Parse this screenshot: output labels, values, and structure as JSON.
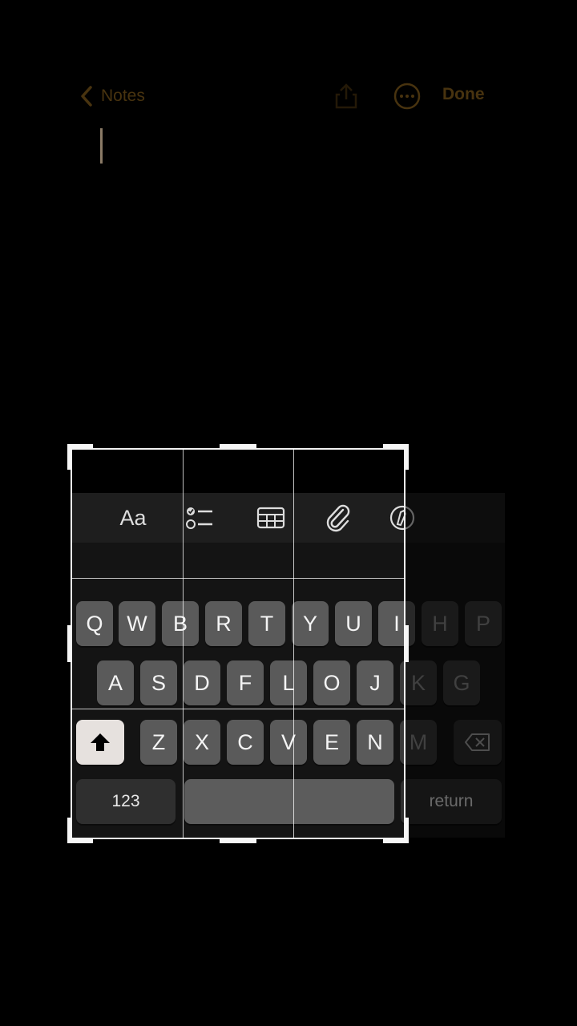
{
  "nav": {
    "back_label": "Notes",
    "done_label": "Done"
  },
  "icons": {
    "back": "chevron-left-icon",
    "share": "share-icon",
    "more": "ellipsis-circle-icon",
    "checklist": "checklist-icon",
    "table": "table-icon",
    "attach": "paperclip-icon",
    "markup": "markup-pen-icon",
    "delete": "backspace-icon",
    "shift": "shift-arrow-icon"
  },
  "toolbar": {
    "format_label": "Aa"
  },
  "keyboard": {
    "row1": [
      "Q",
      "W",
      "B",
      "R",
      "T",
      "Y",
      "U",
      "I",
      "H",
      "P"
    ],
    "row2": [
      "A",
      "S",
      "D",
      "F",
      "L",
      "O",
      "J",
      "K",
      "G"
    ],
    "row3": [
      "Z",
      "X",
      "C",
      "V",
      "E",
      "N",
      "M"
    ],
    "numbers_label": "123",
    "return_label": "return"
  },
  "colors": {
    "accent": "#e0a030",
    "key": "#5a5a5a",
    "background": "#000000"
  }
}
